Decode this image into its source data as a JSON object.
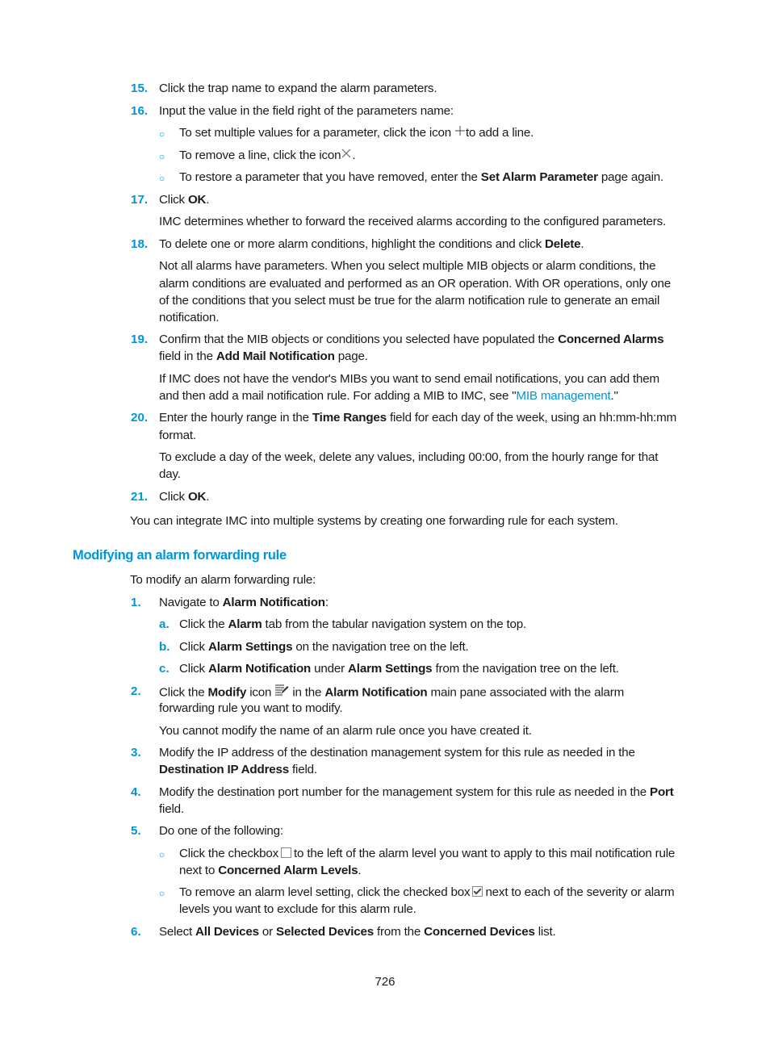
{
  "steps_top": [
    {
      "num": "15.",
      "text": "Click the trap name to expand the alarm parameters."
    },
    {
      "num": "16.",
      "text": "Input the value in the field right of the parameters name:"
    }
  ],
  "bullets_16": [
    {
      "pre": "To set multiple values for a parameter, click the icon",
      "icon": "plus-icon",
      "post": "to add a line."
    },
    {
      "pre": "To remove a line, click the icon",
      "icon": "x-icon",
      "post": "."
    },
    {
      "pre": "To restore a parameter that you have removed, enter the ",
      "bold": "Set Alarm Parameter",
      "post": " page again."
    }
  ],
  "step17": {
    "num": "17.",
    "pre": "Click ",
    "bold": "OK",
    "post": ".",
    "note": "IMC determines whether to forward the received alarms according to the configured parameters."
  },
  "step18": {
    "num": "18.",
    "pre": "To delete one or more alarm conditions, highlight the conditions and click ",
    "bold": "Delete",
    "post": ".",
    "note_lines": [
      "Not all alarms have parameters. When you select multiple MIB objects or alarm conditions, the",
      "alarm conditions are evaluated and performed as an OR operation. With OR operations, only one",
      "of the conditions that you select must be true for the alarm notification rule to generate an email",
      "notification."
    ]
  },
  "step19": {
    "num": "19.",
    "l1_pre": "Confirm that the MIB objects or conditions you selected have populated the ",
    "l1_bold": "Concerned Alarms",
    "l2_pre": "field in the ",
    "l2_bold": "Add Mail Notification",
    "l2_post": " page.",
    "note_l1": "If IMC does not have the vendor's MIBs you want to send email notifications, you can add them",
    "note_l2_pre": "and then add a mail notification rule. For adding a MIB to IMC, see \"",
    "note_l2_link": "MIB management",
    "note_l2_post": ".\""
  },
  "step20": {
    "num": "20.",
    "l1_pre": "Enter the hourly range in the ",
    "l1_bold": "Time Ranges",
    "l1_post": " field for each day of the week, using an hh:mm-hh:mm",
    "l2": "format.",
    "note_l1": "To exclude a day of the week, delete any values, including 00:00, from the hourly range for that",
    "note_l2": "day."
  },
  "step21": {
    "num": "21.",
    "pre": "Click ",
    "bold": "OK",
    "post": "."
  },
  "closing": "You can integrate IMC into multiple systems by creating one forwarding rule for each system.",
  "section": {
    "heading": "Modifying an alarm forwarding rule",
    "intro": "To modify an alarm forwarding rule:",
    "step1": {
      "num": "1.",
      "pre": "Navigate to ",
      "bold": "Alarm Notification",
      "post": ":"
    },
    "substeps": [
      {
        "num": "a.",
        "pre": "Click the ",
        "bold1": "Alarm",
        "mid": " tab from the tabular navigation system on the top.",
        "bold2": "",
        "post": ""
      },
      {
        "num": "b.",
        "pre": "Click ",
        "bold1": "Alarm Settings",
        "mid": " on the navigation tree on the left.",
        "bold2": "",
        "post": ""
      },
      {
        "num": "c.",
        "pre": "Click ",
        "bold1": "Alarm Notification",
        "mid": " under ",
        "bold2": "Alarm Settings",
        "post": " from the navigation tree on the left."
      }
    ],
    "step2": {
      "num": "2.",
      "l1_pre": "Click the ",
      "l1_bold1": "Modify",
      "l1_mid": " icon ",
      "l1_mid2": " in the ",
      "l1_bold2": "Alarm Notification",
      "l1_post": " main pane associated with the alarm",
      "l2": "forwarding rule you want to modify.",
      "note": "You cannot modify the name of an alarm rule once you have created it."
    },
    "step3": {
      "num": "3.",
      "l1": "Modify the IP address of the destination management system for this rule as needed in the",
      "l2_bold": "Destination IP Address",
      "l2_post": " field."
    },
    "step4": {
      "num": "4.",
      "l1_pre": "Modify the destination port number for the management system for this rule as needed in the ",
      "l1_bold": "Port",
      "l2": "field."
    },
    "step5": {
      "num": "5.",
      "text": "Do one of the following:",
      "b1_l1_pre": "Click the checkbox",
      "b1_l1_post": "to the left of the alarm level you want to apply to this mail notification rule",
      "b1_l2_pre": "next to ",
      "b1_l2_bold": "Concerned Alarm Levels",
      "b1_l2_post": ".",
      "b2_l1_pre": "To remove an alarm level setting, click the checked box",
      "b2_l1_post": "next to each of the severity or alarm",
      "b2_l2": "levels you want to exclude for this alarm rule."
    },
    "step6": {
      "num": "6.",
      "pre": "Select ",
      "bold1": "All Devices",
      "mid1": " or ",
      "bold2": "Selected Devices",
      "mid2": " from the ",
      "bold3": "Concerned Devices",
      "post": " list."
    }
  },
  "page_number": "726",
  "colors": {
    "accent": "#0096d6",
    "text": "#1a1a1a"
  }
}
